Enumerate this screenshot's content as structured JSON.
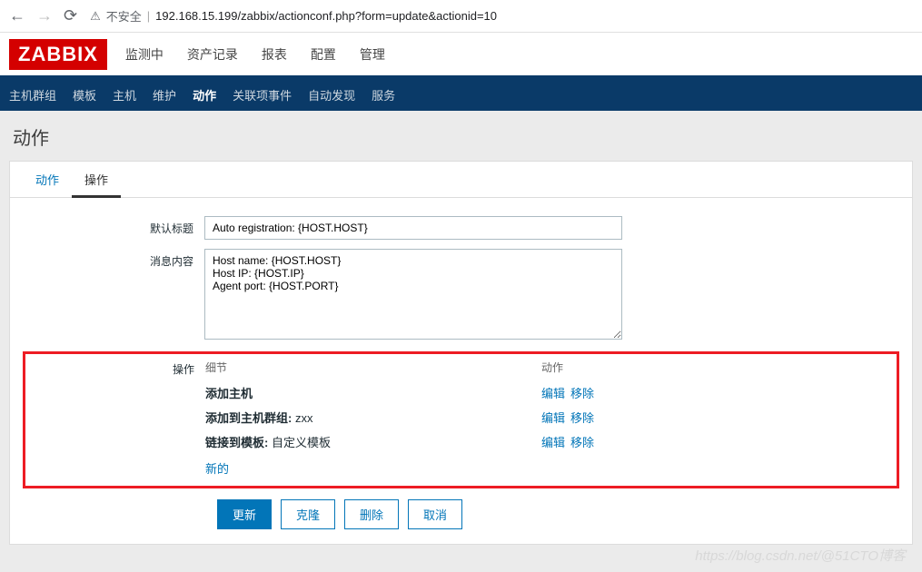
{
  "browser": {
    "insecure_label": "不安全",
    "url": "192.168.15.199/zabbix/actionconf.php?form=update&actionid=10"
  },
  "logo": "ZABBIX",
  "topmenu": [
    {
      "label": "监测中"
    },
    {
      "label": "资产记录"
    },
    {
      "label": "报表"
    },
    {
      "label": "配置",
      "active": true
    },
    {
      "label": "管理"
    }
  ],
  "submenu": [
    {
      "label": "主机群组"
    },
    {
      "label": "模板"
    },
    {
      "label": "主机"
    },
    {
      "label": "维护"
    },
    {
      "label": "动作",
      "active": true
    },
    {
      "label": "关联项事件"
    },
    {
      "label": "自动发现"
    },
    {
      "label": "服务"
    }
  ],
  "page_title": "动作",
  "tabs": [
    {
      "label": "动作"
    },
    {
      "label": "操作",
      "active": true
    }
  ],
  "form": {
    "default_subject_label": "默认标题",
    "default_subject_value": "Auto registration: {HOST.HOST}",
    "default_message_label": "消息内容",
    "default_message_value": "Host name: {HOST.HOST}\nHost IP: {HOST.IP}\nAgent port: {HOST.PORT}"
  },
  "ops": {
    "section_label": "操作",
    "col_detail": "细节",
    "col_action": "动作",
    "rows": [
      {
        "detail_bold": "添加主机",
        "detail_rest": ""
      },
      {
        "detail_bold": "添加到主机群组:",
        "detail_rest": " zxx"
      },
      {
        "detail_bold": "链接到模板:",
        "detail_rest": " 自定义模板"
      }
    ],
    "edit": "编辑",
    "remove": "移除",
    "new": "新的"
  },
  "buttons": {
    "update": "更新",
    "clone": "克隆",
    "delete": "删除",
    "cancel": "取消"
  },
  "watermark": "https://blog.csdn.net/@51CTO博客"
}
